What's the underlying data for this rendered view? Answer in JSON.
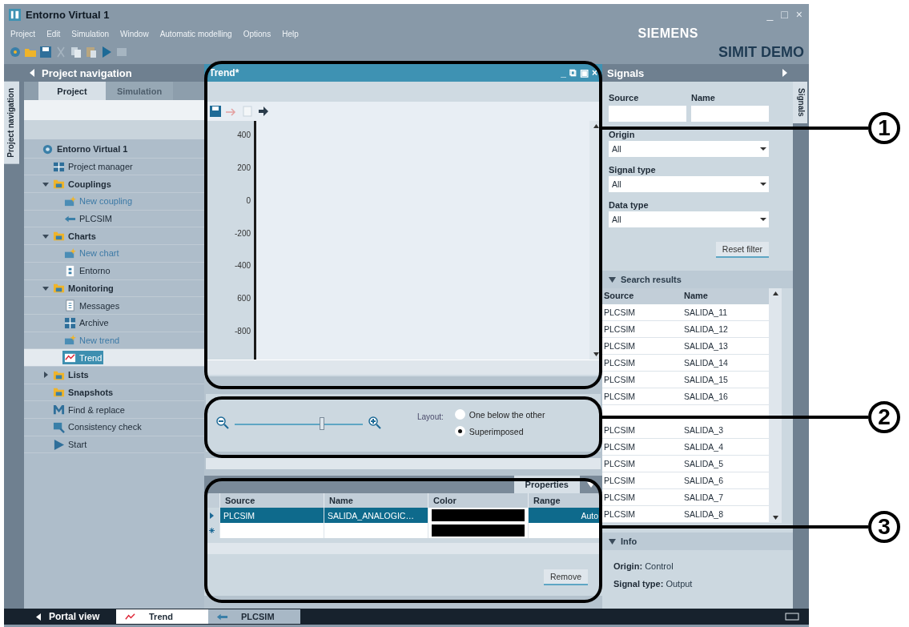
{
  "window": {
    "title": "Entorno Virtual 1",
    "controls": [
      "_",
      "□",
      "×"
    ]
  },
  "menu": [
    "Project",
    "Edit",
    "Simulation",
    "Window",
    "Automatic modelling",
    "Options",
    "Help"
  ],
  "branding": {
    "company": "SIEMENS",
    "product": "SIMIT DEMO"
  },
  "project_navigation": {
    "title": "Project navigation",
    "side_tab": "Project navigation",
    "tabs": [
      {
        "label": "Project",
        "selected": true
      },
      {
        "label": "Simulation",
        "selected": false
      }
    ],
    "tree": [
      {
        "label": "Entorno Virtual 1",
        "kind": "project",
        "selected": false,
        "children": [
          {
            "label": "Project manager",
            "kind": "manager",
            "selected": false
          },
          {
            "label": "Couplings",
            "kind": "folder",
            "expanded": true,
            "selected": false,
            "children": [
              {
                "label": "New coupling",
                "kind": "new",
                "selected": false
              },
              {
                "label": "PLCSIM",
                "kind": "coupling",
                "selected": false
              }
            ]
          },
          {
            "label": "Charts",
            "kind": "folder",
            "expanded": true,
            "selected": false,
            "children": [
              {
                "label": "New chart",
                "kind": "new",
                "selected": false
              },
              {
                "label": "Entorno",
                "kind": "chart",
                "selected": false
              }
            ]
          },
          {
            "label": "Monitoring",
            "kind": "folder",
            "expanded": true,
            "selected": false,
            "children": [
              {
                "label": "Messages",
                "kind": "messages",
                "selected": false
              },
              {
                "label": "Archive",
                "kind": "archive",
                "selected": false
              },
              {
                "label": "New trend",
                "kind": "new",
                "selected": false
              },
              {
                "label": "Trend",
                "kind": "trend",
                "selected": true
              }
            ]
          },
          {
            "label": "Lists",
            "kind": "folder",
            "expanded": false,
            "selected": false
          },
          {
            "label": "Snapshots",
            "kind": "folder",
            "selected": false
          },
          {
            "label": "Find & replace",
            "kind": "find",
            "selected": false
          },
          {
            "label": "Consistency check",
            "kind": "check",
            "selected": false
          },
          {
            "label": "Start",
            "kind": "start",
            "selected": false
          }
        ]
      }
    ]
  },
  "trend": {
    "title": "Trend*",
    "controls": [
      "_",
      "⧉",
      "▣",
      "×"
    ],
    "y_labels": [
      "400",
      "200",
      "0",
      "-200",
      "-400",
      "600",
      "-800"
    ],
    "zoom": {
      "level": 0.68
    },
    "layout_label": "Layout:",
    "layout_options": [
      {
        "label": "One below the other",
        "selected": false
      },
      {
        "label": "Superimposed",
        "selected": true
      }
    ]
  },
  "properties": {
    "tab": "Properties",
    "columns": [
      "Source",
      "Name",
      "Color",
      "Range"
    ],
    "rows": [
      {
        "kind": "signal",
        "source": "PLCSIM",
        "name": "SALIDA_ANALOGIC…",
        "color": "#000000",
        "range": "Auto",
        "selected": true
      },
      {
        "kind": "new",
        "color": "#000000",
        "selected": false
      }
    ],
    "remove_button": "Remove"
  },
  "signals": {
    "title": "Signals",
    "side_tab": "Signals",
    "source_label": "Source",
    "name_label": "Name",
    "dropdowns": [
      {
        "label": "Origin",
        "value": "All"
      },
      {
        "label": "Signal type",
        "value": "All"
      },
      {
        "label": "Data type",
        "value": "All"
      }
    ],
    "reset_button": "Reset filter",
    "search_results": {
      "title": "Search results",
      "columns": [
        "Source",
        "Name"
      ],
      "rows": [
        [
          "PLCSIM",
          "SALIDA_11"
        ],
        [
          "PLCSIM",
          "SALIDA_12"
        ],
        [
          "PLCSIM",
          "SALIDA_13"
        ],
        [
          "PLCSIM",
          "SALIDA_14"
        ],
        [
          "PLCSIM",
          "SALIDA_15"
        ],
        [
          "PLCSIM",
          "SALIDA_16"
        ],
        [
          "PLCSIM",
          "SALIDA_3"
        ],
        [
          "PLCSIM",
          "SALIDA_4"
        ],
        [
          "PLCSIM",
          "SALIDA_5"
        ],
        [
          "PLCSIM",
          "SALIDA_6"
        ],
        [
          "PLCSIM",
          "SALIDA_7"
        ],
        [
          "PLCSIM",
          "SALIDA_8"
        ]
      ]
    },
    "info": {
      "title": "Info",
      "fields": [
        {
          "label": "Origin:",
          "value": "Control"
        },
        {
          "label": "Signal type:",
          "value": "Output"
        }
      ]
    }
  },
  "taskbar": {
    "portal_view": "Portal view",
    "tasks": [
      {
        "label": "Trend",
        "kind": "trend",
        "selected": true
      },
      {
        "label": "PLCSIM",
        "kind": "coupling",
        "selected": false
      }
    ]
  },
  "callouts": [
    {
      "number": "1"
    },
    {
      "number": "2"
    },
    {
      "number": "3"
    }
  ]
}
